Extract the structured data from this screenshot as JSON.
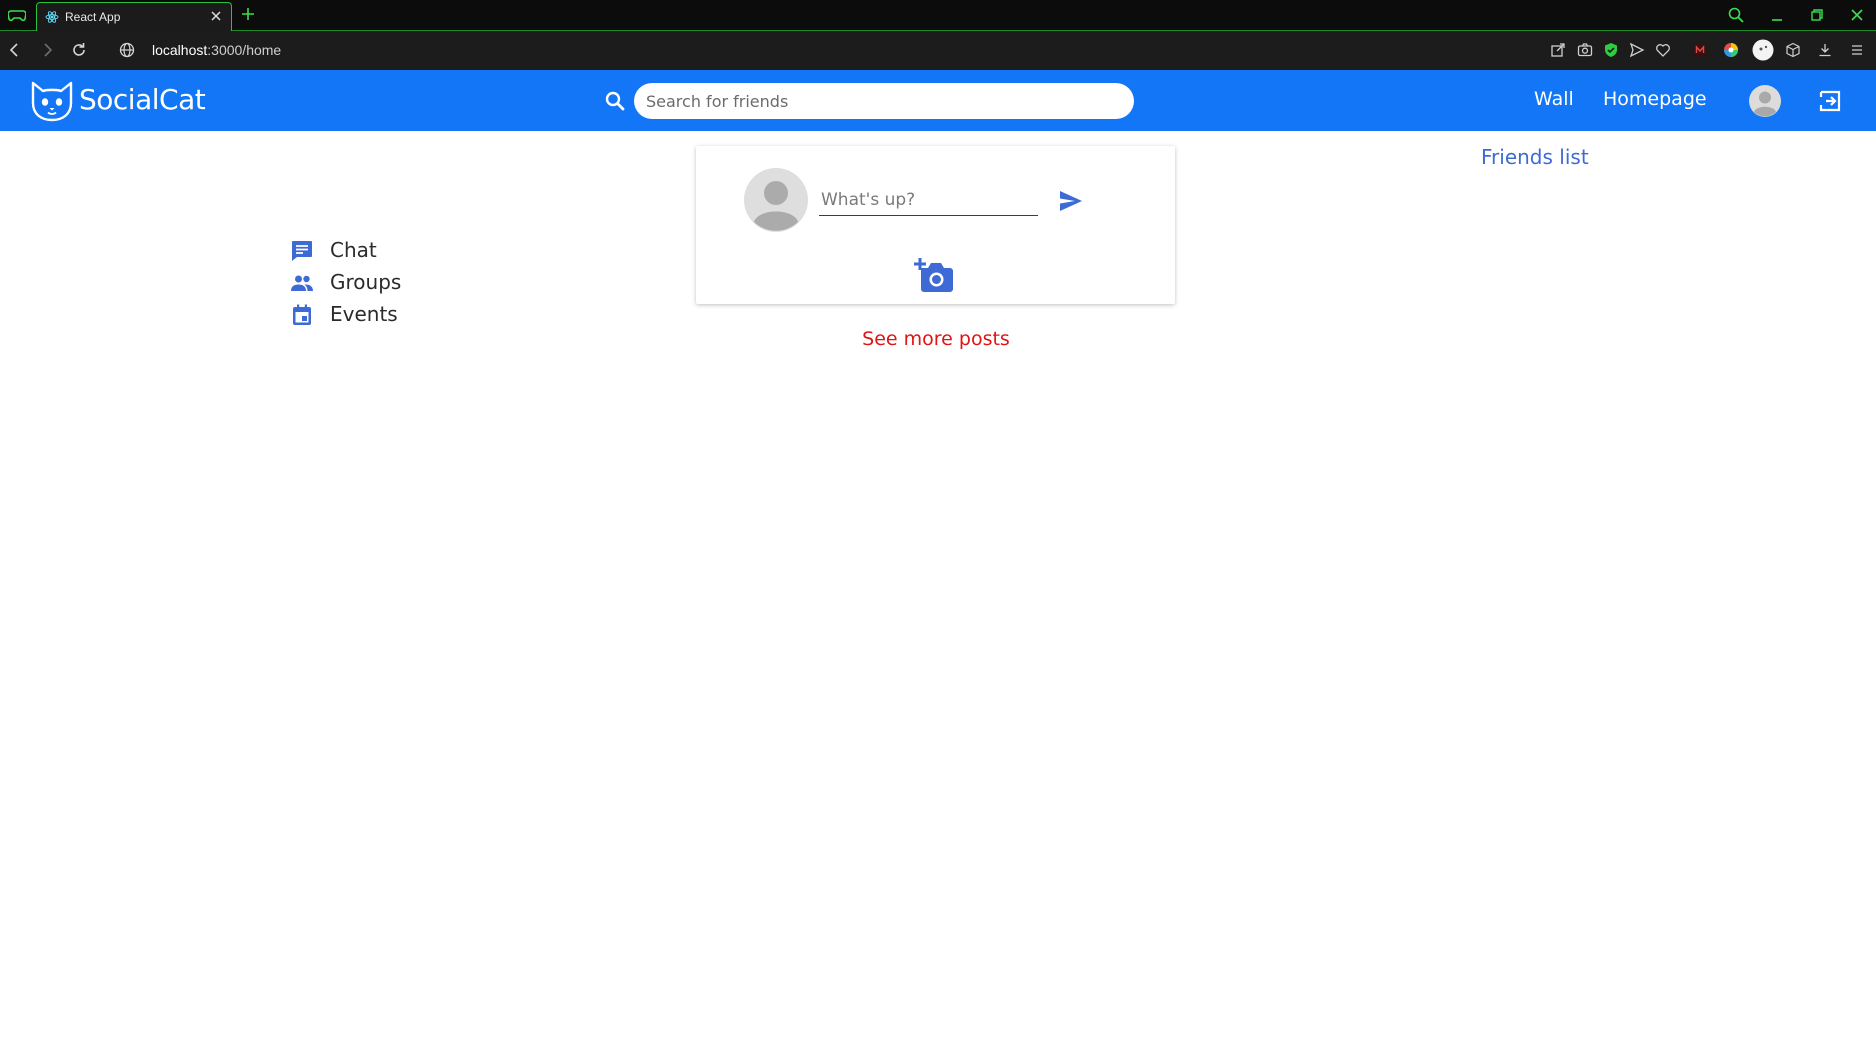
{
  "browser": {
    "tab_title": "React App",
    "url_host": "localhost",
    "url_path": ":3000/home"
  },
  "app": {
    "logo_text": "SocialCat",
    "search": {
      "placeholder": "Search for friends",
      "value": ""
    },
    "nav": {
      "wall": "Wall",
      "homepage": "Homepage"
    }
  },
  "sidebar": {
    "items": [
      {
        "label": "Chat",
        "icon": "chat-icon"
      },
      {
        "label": "Groups",
        "icon": "groups-icon"
      },
      {
        "label": "Events",
        "icon": "calendar-icon"
      }
    ]
  },
  "composer": {
    "placeholder": "What's up?",
    "value": ""
  },
  "see_more": "See more posts",
  "friends_list": "Friends list",
  "colors": {
    "appbar": "#1276f7",
    "accent": "#3e6ad6",
    "danger": "#e11414"
  }
}
